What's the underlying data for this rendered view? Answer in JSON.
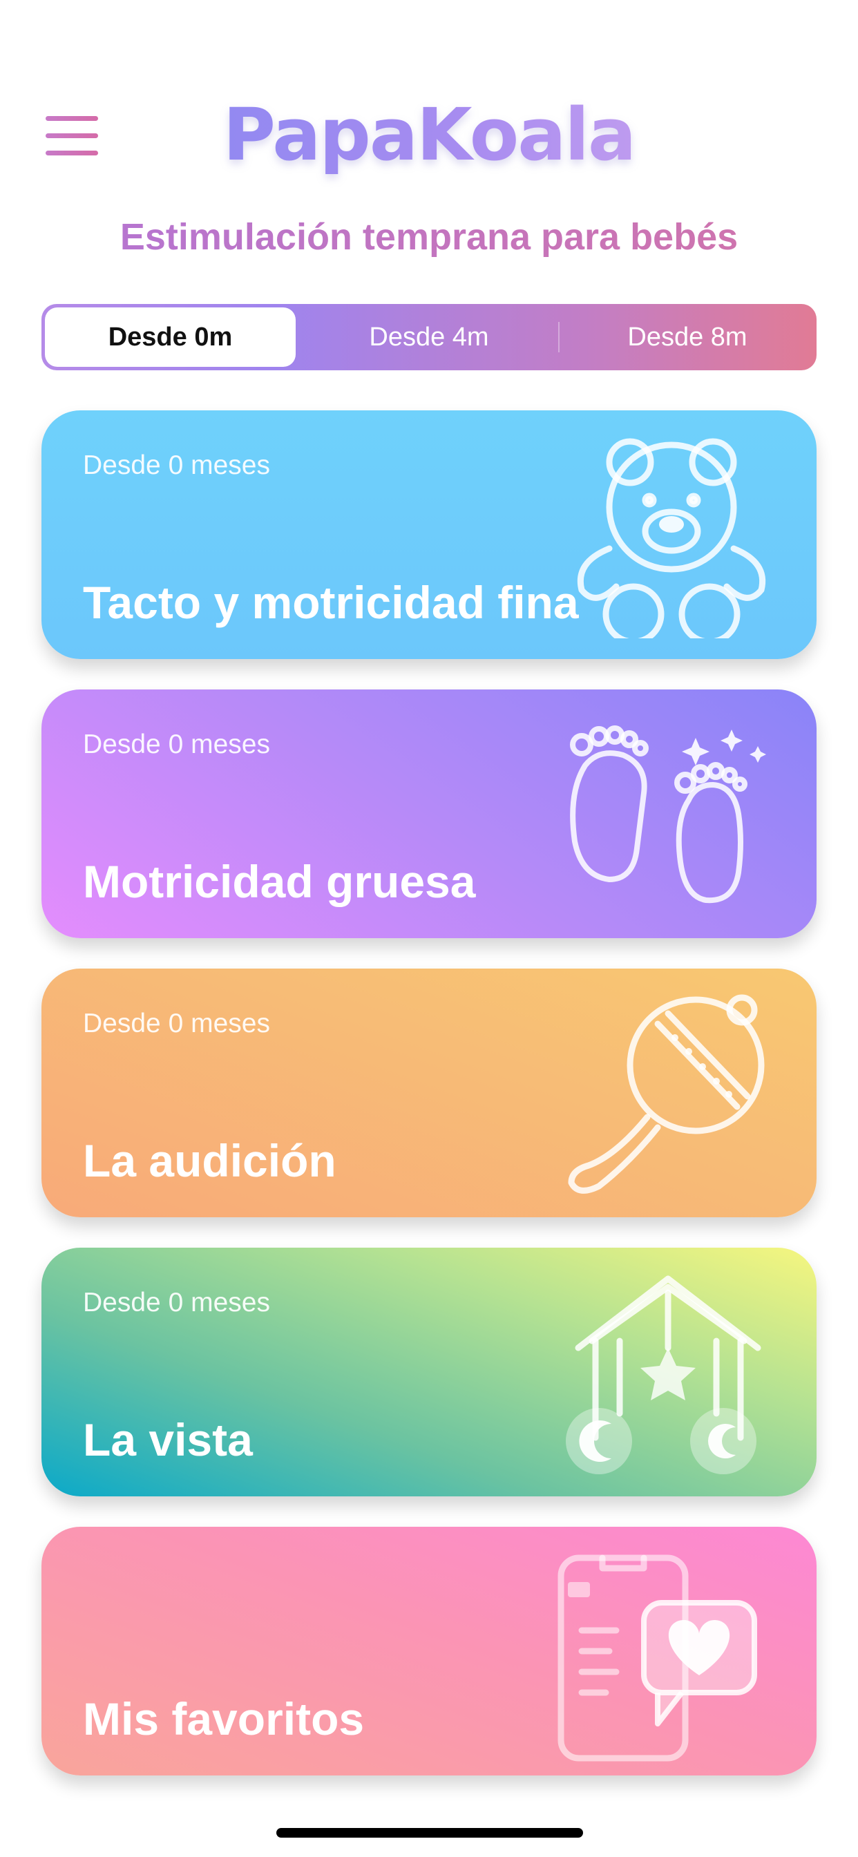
{
  "header": {
    "logo": "PapaKoala",
    "subtitle": "Estimulación temprana para bebés"
  },
  "tabs": [
    {
      "label": "Desde 0m",
      "active": true
    },
    {
      "label": "Desde 4m",
      "active": false
    },
    {
      "label": "Desde 8m",
      "active": false
    }
  ],
  "cards": [
    {
      "age": "Desde 0 meses",
      "title": "Tacto y motricidad fina",
      "icon": "teddy-bear-icon"
    },
    {
      "age": "Desde 0 meses",
      "title": "Motricidad gruesa",
      "icon": "baby-feet-icon"
    },
    {
      "age": "Desde 0 meses",
      "title": "La audición",
      "icon": "rattle-icon"
    },
    {
      "age": "Desde 0 meses",
      "title": "La vista",
      "icon": "crib-mobile-icon"
    },
    {
      "age": "",
      "title": "Mis favoritos",
      "icon": "phone-heart-icon"
    }
  ],
  "colors": {
    "card_touch": "#6fd1fb",
    "card_gross_motor": "#b58af8",
    "card_hearing": "#f7bc76",
    "card_vision": "#6bc3a1",
    "card_favorites": "#fb94b5"
  }
}
